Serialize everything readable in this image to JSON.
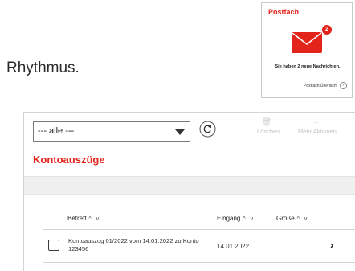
{
  "intro_text": "Rhythmus.",
  "postfach": {
    "title": "Postfach",
    "badge_count": "2",
    "message": "Sie haben 2 neue Nachrichten.",
    "overview_link": "Postfach Übersicht",
    "accent_color": "#e2241b"
  },
  "toolbar": {
    "filter_value": "--- alle ---",
    "delete_label": "Löschen",
    "more_actions_label": "Mehr Aktionen"
  },
  "section_title": "Kontoauszüge",
  "table": {
    "columns": [
      "Betreff",
      "Eingang",
      "Größe"
    ],
    "sort_indicator": "^ v",
    "rows": [
      {
        "subject": "Kontoauszug 01/2022 vom 14.01.2022 zu Konto 123456",
        "date": "14.01.2022",
        "size": ""
      }
    ]
  }
}
